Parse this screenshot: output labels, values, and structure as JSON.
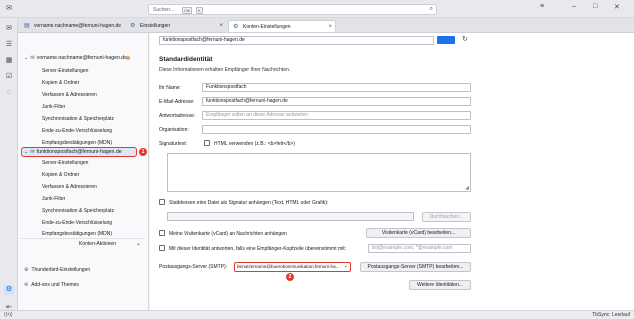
{
  "colors": {
    "accent": "#1a73e8",
    "highlight": "#e03a2a",
    "selection": "#dde6f3",
    "warning_dot": "#e8a25a"
  },
  "search": {
    "placeholder": "Suchen...",
    "shortcut_key1": "Ctrl",
    "shortcut_key2": "K",
    "icon": "search-icon"
  },
  "tabs": [
    {
      "label": "vorname.nachname@fernuni-hagen.de",
      "icon": "inbox-icon"
    },
    {
      "label": "Einstellungen",
      "icon": "gear-icon"
    },
    {
      "label": "Konten-Einstellungen",
      "icon": "gear-icon"
    }
  ],
  "spaces": [
    "mail-icon",
    "address-book-icon",
    "calendar-icon",
    "tasks-icon",
    "chat-icon",
    "settings-icon",
    "collapse-icon"
  ],
  "accounts": [
    {
      "name": "vorname.nachname@fernuni-hagen.de",
      "items": [
        "Server-Einstellungen",
        "Kopien & Ordner",
        "Verfassen & Adressieren",
        "Junk-Filter",
        "Synchronisation & Speicherplatz",
        "Ende-zu-Ende-Verschlüsselung",
        "Empfangsbestätigungen (MDN)"
      ]
    },
    {
      "name": "funktionspostfach@fernuni-hagen.de",
      "badge": "1",
      "items": [
        "Server-Einstellungen",
        "Kopien & Ordner",
        "Verfassen & Adressieren",
        "Junk-Filter",
        "Synchronisation & Speicherplatz",
        "Ende-zu-Ende-Verschlüsselung",
        "Empfangsbestätigungen (MDN)"
      ]
    }
  ],
  "account_actions": "Konten-Aktionen",
  "bottom_links": [
    {
      "label": "Thunderbird-Einstellungen",
      "icon": "gear-icon"
    },
    {
      "label": "Add-ons und Themes",
      "icon": "puzzle-icon"
    }
  ],
  "main": {
    "account_name": "funktionspostfach@fernuni-hagen.de",
    "section_title": "Standardidentität",
    "section_desc": "Diese Informationen erhalten Empfänger Ihrer Nachrichten.",
    "fields": [
      {
        "label": "Ihr Name:",
        "value": "Funktionspostfach",
        "placeholder": ""
      },
      {
        "label": "E-Mail-Adresse:",
        "value": "funktionspostfach@fernuni-hagen.de",
        "placeholder": ""
      },
      {
        "label": "Antwortadresse:",
        "value": "",
        "placeholder": "Empfänger sollen an diese Adresse antworten"
      },
      {
        "label": "Organisation:",
        "value": "",
        "placeholder": ""
      }
    ],
    "signature_label": "Signaturtext:",
    "html_checkbox": "HTML verwenden (z.B.: <b>fett</b>)",
    "attach_file_checkbox": "Stattdessen eine Datei als Signatur anhängen (Text, HTML oder Grafik):",
    "browse_button": "Durchsuchen...",
    "vcard_checkbox": "Meine Visitenkarte (vCard) an Nachrichten anhängen",
    "vcard_button": "Visitenkarte (vCard) bearbeiten...",
    "reply_checkbox": "Mit dieser Identität antworten, falls eine Empfänger-Kopfzeile übereinstimmt mit:",
    "reply_placeholder": "list@example.com, *@example.com",
    "smtp_label": "Postausgangs-Server (SMTP):",
    "smtp_value": "benutzername@buerokommunikation.fernuni-ha...",
    "smtp_badge": "2",
    "smtp_button": "Postausgangs-Server (SMTP) bearbeiten...",
    "identities_button": "Weitere Identitäten..."
  },
  "status": {
    "text": "TbSync: Leerlauf",
    "icon": "wifi-icon"
  }
}
